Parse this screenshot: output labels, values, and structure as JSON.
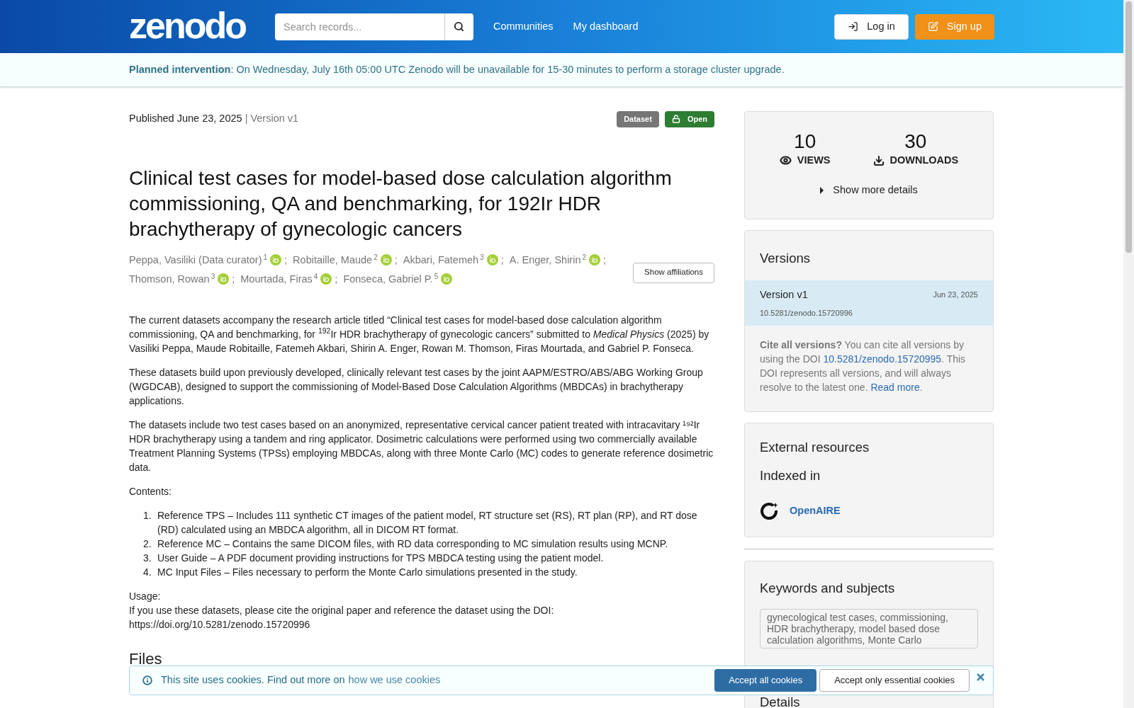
{
  "header": {
    "logo": "zenodo",
    "search": {
      "placeholder": "Search records..."
    },
    "nav": [
      "Communities",
      "My dashboard"
    ],
    "login": "Log in",
    "signup": "Sign up"
  },
  "notice": "**Planned intervention**: On Wednesday, July 16th 05:00 UTC Zenodo will be unavailable for 15-30 minutes to perform a storage cluster upgrade.",
  "record": {
    "published": "Published June 23, 2025",
    "version": "| Version v1",
    "badges": [
      {
        "label": "Dataset",
        "kind": "type"
      },
      {
        "label": "Open",
        "kind": "access"
      }
    ],
    "title": "Clinical test cases for model-based dose calculation algorithm commissioning, QA and benchmarking, for 192Ir HDR brachytherapy of gynecologic cancers",
    "authors": [
      {
        "name": "Peppa, Vasiliki (Data curator)",
        "aff": "1",
        "sep": ";"
      },
      {
        "name": "Robitaille, Maude",
        "aff": "2",
        "sep": ";"
      },
      {
        "name": "Akbari, Fatemeh",
        "aff": "3",
        "sep": ";"
      },
      {
        "name": "A. Enger, Shirin",
        "aff": "2",
        "sep": ";"
      },
      {
        "name": "Thomson, Rowan",
        "aff": "3",
        "sep": ";"
      },
      {
        "name": "Mourtada, Firas",
        "aff": "4",
        "sep": ";"
      },
      {
        "name": "Fonseca, Gabriel P.",
        "aff": "5"
      }
    ],
    "show_affiliations": "Show affiliations",
    "description": [
      "The current datasets accompany the research article titled “Clinical test cases for model-based dose calculation algorithm commissioning, QA and benchmarking, for $^{192}$Ir HDR brachytherapy of gynecologic cancers” submitted to *Medical Physics* (2025) by Vasiliki Peppa, Maude Robitaille, Fatemeh Akbari, Shirin A. Enger, Rowan M. Thomson, Firas Mourtada, and Gabriel P. Fonseca.",
      "These datasets build upon previously developed, clinically relevant test cases by the joint AAPM/ESTRO/ABS/ABG Working Group (WGDCAB), designed to support the commissioning of Model-Based Dose Calculation Algorithms (MBDCAs) in brachytherapy applications.",
      "The datasets include two test cases based on an anonymized, representative cervical cancer patient treated with intracavitary ¹⁹²Ir HDR brachytherapy using a tandem and ring applicator. Dosimetric calculations were performed using two commercially available Treatment Planning Systems (TPSs) employing MBDCAs, along with three Monte Carlo (MC) codes to generate reference dosimetric data.",
      "Contents:"
    ],
    "contents": [
      {
        "num": "1.",
        "text": "Reference TPS – Includes 111 synthetic CT images of the patient model, RT structure set (RS), RT plan (RP), and RT dose (RD) calculated using an MBDCA algorithm, all in DICOM RT format."
      },
      {
        "num": "2.",
        "text": "Reference MC – Contains the same DICOM files, with RD data corresponding to MC simulation results using MCNP."
      },
      {
        "num": "3.",
        "text": "User Guide – A PDF document providing instructions for TPS MBDCA testing using the patient model."
      },
      {
        "num": "4.",
        "text": "MC Input Files – Files necessary to perform the Monte Carlo simulations presented in the study."
      }
    ],
    "usage": [
      "Usage:",
      "If you use these datasets, please cite the original paper and reference the dataset using the DOI:",
      "https://doi.org/10.5281/zenodo.15720996"
    ],
    "files_heading": "Files"
  },
  "sidebar": {
    "stats": [
      {
        "value": "10",
        "label": "VIEWS",
        "kind": "views"
      },
      {
        "value": "30",
        "label": "DOWNLOADS",
        "kind": "downloads"
      }
    ],
    "more_details": "Show more details",
    "versions": {
      "heading": "Versions",
      "items": [
        {
          "name": "Version v1",
          "date": "Jun 23, 2025",
          "doi": "10.5281/zenodo.15720996",
          "selected": true
        }
      ],
      "cite_bold": "Cite all versions?",
      "cite_pre": "You can cite all versions by using the DOI",
      "cite_doi": "10.5281/zenodo.15720995",
      "cite_post": ". This DOI represents all versions, and will always resolve to the latest one.",
      "read_more": "Read more",
      "period": "."
    },
    "external": {
      "heading": "External resources",
      "subheading": "Indexed in",
      "link": "OpenAIRE"
    },
    "keywords": {
      "heading": "Keywords and subjects",
      "value": "gynecological test cases, commissioning, HDR brachytherapy, model based dose calculation algorithms, Monte Carlo"
    },
    "details_heading": "Details"
  },
  "cookies": {
    "text": "This site uses cookies. Find out more on",
    "link": "how we use cookies",
    "accept_all": "Accept all cookies",
    "accept_essential": "Accept only essential cookies"
  }
}
